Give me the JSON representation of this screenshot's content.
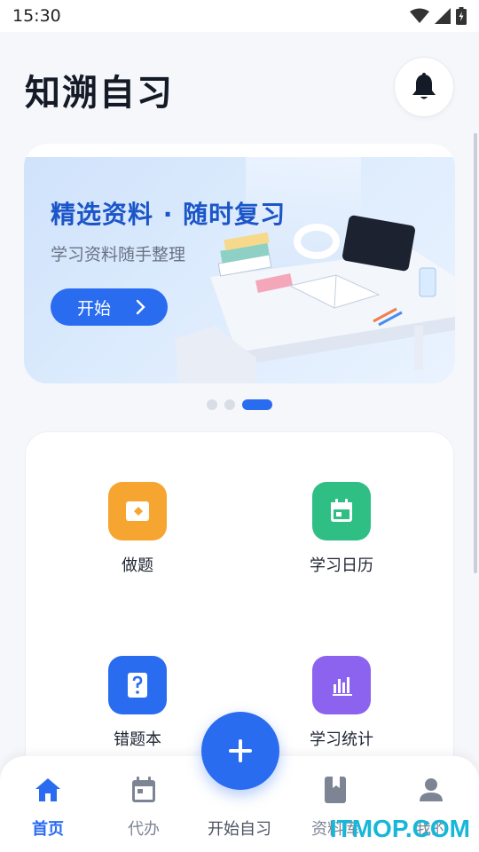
{
  "status_bar": {
    "time": "15:30"
  },
  "header": {
    "title": "知溯自习",
    "bell_icon": "bell-icon"
  },
  "banner": {
    "title": "精选资料 · 随时复习",
    "subtitle": "学习资料随手整理",
    "button_label": "开始",
    "carousel_dots": 3,
    "active_dot": 3
  },
  "features": [
    {
      "label": "做题",
      "icon": "ticket-icon",
      "color": "#f7a531"
    },
    {
      "label": "学习日历",
      "icon": "calendar-icon",
      "color": "#2fbf84"
    },
    {
      "label": "错题本",
      "icon": "question-icon",
      "color": "#2a6cf0"
    },
    {
      "label": "学习统计",
      "icon": "bar-chart-icon",
      "color": "#8b63ee"
    }
  ],
  "bottom_nav": {
    "items": [
      {
        "label": "首页",
        "icon": "home-icon",
        "active": true
      },
      {
        "label": "代办",
        "icon": "calendar-icon",
        "active": false
      },
      {
        "label": "开始自习",
        "icon": "plus-icon",
        "active": false
      },
      {
        "label": "资料库",
        "icon": "book-icon",
        "active": false
      },
      {
        "label": "我的",
        "icon": "person-icon",
        "active": false
      }
    ]
  },
  "watermark": "ITMOP.COM",
  "colors": {
    "accent": "#2a6cf0",
    "background": "#f5f7fb"
  }
}
